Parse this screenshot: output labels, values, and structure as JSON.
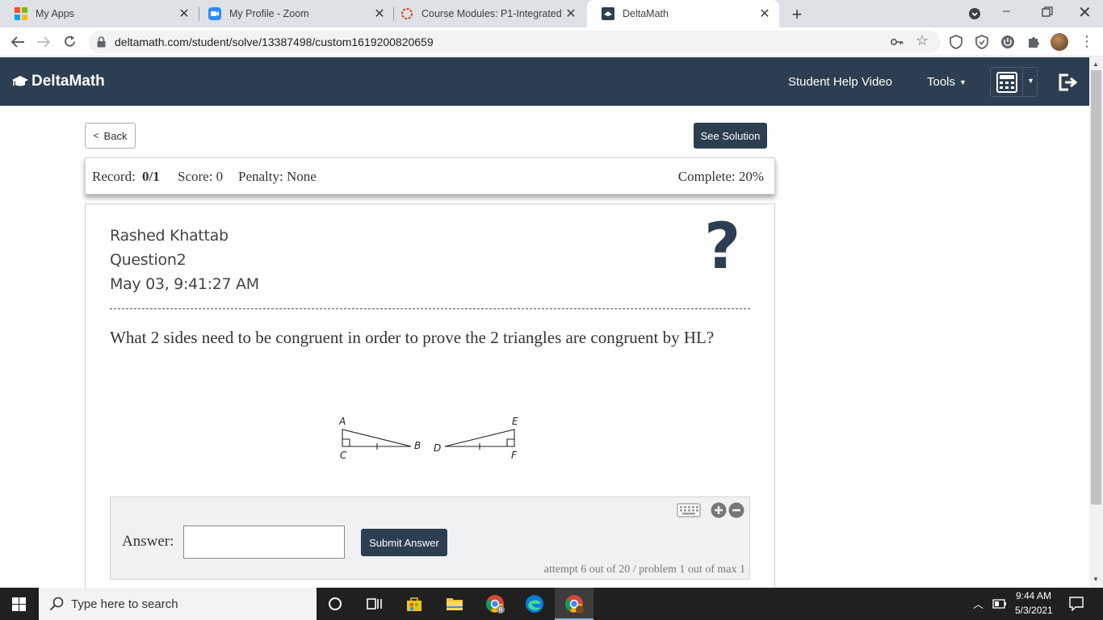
{
  "browser": {
    "tabs": [
      {
        "title": "My Apps",
        "active": false
      },
      {
        "title": "My Profile - Zoom",
        "active": false
      },
      {
        "title": "Course Modules: P1-Integrated M",
        "active": false
      },
      {
        "title": "DeltaMath",
        "active": true
      }
    ],
    "new_tab_icon": "plus-icon",
    "url": "deltamath.com/student/solve/13387498/custom1619200820659"
  },
  "header": {
    "brand": "DeltaMath",
    "help_video": "Student Help Video",
    "tools": "Tools"
  },
  "nav": {
    "back": "Back",
    "see_solution": "See Solution"
  },
  "record_bar": {
    "record_label": "Record:",
    "record_value": "0/1",
    "score": "Score: 0",
    "penalty": "Penalty: None",
    "complete": "Complete: 20%"
  },
  "problem": {
    "student_name": "Rashed Khattab",
    "question_name": "Question2",
    "timestamp": "May 03, 9:41:27 AM",
    "help_symbol": "?",
    "question_text": "What 2 sides need to be congruent in order to prove the 2 triangles are congruent by HL?",
    "diagram_labels": {
      "A": "A",
      "B": "B",
      "C": "C",
      "D": "D",
      "E": "E",
      "F": "F"
    }
  },
  "answer": {
    "label": "Answer:",
    "value": "",
    "submit": "Submit Answer",
    "attempts": "attempt 6 out of 20 / problem 1 out of max 1"
  },
  "taskbar": {
    "search_placeholder": "Type here to search",
    "time": "9:44 AM",
    "date": "5/3/2021"
  },
  "colors": {
    "header_bg": "#2c3e50",
    "button_dark": "#2c3e50",
    "tabstrip_bg": "#dee1e6",
    "taskbar_bg": "#202020"
  }
}
